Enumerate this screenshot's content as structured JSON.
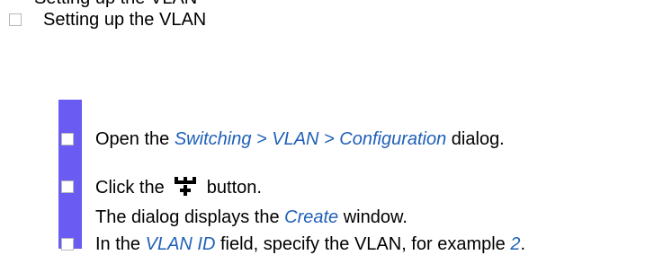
{
  "cut_line": {
    "text": "Setting up the VLAN"
  },
  "section": {
    "heading": "Setting up the VLAN"
  },
  "steps": {
    "step1": {
      "before": "Open the ",
      "path": "Switching > VLAN > Configuration",
      "after": " dialog."
    },
    "step2": {
      "before": "Click the ",
      "icon": "add-vlan-icon",
      "after": " button.",
      "result_before": "The dialog displays the ",
      "result_ref": "Create",
      "result_after": " window."
    },
    "step3": {
      "before": "In the ",
      "field": "VLAN ID",
      "middle": " field, specify the VLAN, for example ",
      "example": "2",
      "after": "."
    }
  },
  "colors": {
    "side_bar": "#6a5bf2",
    "reference_text": "#1f5fb8",
    "checkbox_border": "#b8b8b8"
  }
}
